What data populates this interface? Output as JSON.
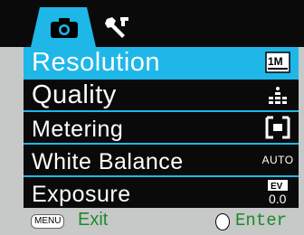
{
  "tabs": [
    {
      "name": "camera",
      "active": true
    },
    {
      "name": "setup",
      "active": false
    }
  ],
  "menu": {
    "items": [
      {
        "label": "Resolution",
        "value_icon": "resolution-1m-icon",
        "value_text": "1M"
      },
      {
        "label": "Quality",
        "value_icon": "quality-dots-icon"
      },
      {
        "label": "Metering",
        "value_icon": "metering-center-icon"
      },
      {
        "label": "White Balance",
        "value_icon": "wb-auto-icon",
        "value_text": "AUTO"
      },
      {
        "label": "Exposure",
        "value_icon": "ev-icon",
        "value_text": "0.0",
        "value_badge": "EV"
      }
    ],
    "selected_index": 0
  },
  "footer": {
    "menu_key": "MENU",
    "exit_label": "Exit",
    "enter_label": "Enter"
  },
  "colors": {
    "accent": "#1fb7e8",
    "background": "#0a0a0a",
    "footer_bg": "#c7c9c8",
    "footer_text": "#1c8a2c"
  }
}
